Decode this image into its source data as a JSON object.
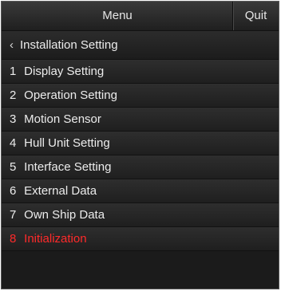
{
  "header": {
    "title": "Menu",
    "quit_label": "Quit"
  },
  "breadcrumb": {
    "back_icon": "‹",
    "label": "Installation Setting"
  },
  "menu": {
    "items": [
      {
        "number": "1",
        "label": "Display Setting"
      },
      {
        "number": "2",
        "label": "Operation Setting"
      },
      {
        "number": "3",
        "label": "Motion Sensor"
      },
      {
        "number": "4",
        "label": "Hull Unit Setting"
      },
      {
        "number": "5",
        "label": "Interface Setting"
      },
      {
        "number": "6",
        "label": "External Data"
      },
      {
        "number": "7",
        "label": "Own Ship Data"
      },
      {
        "number": "8",
        "label": "Initialization"
      }
    ]
  },
  "colors": {
    "active_item": "#ff2a2a",
    "text": "#ececec",
    "background": "#1b1b1b"
  }
}
